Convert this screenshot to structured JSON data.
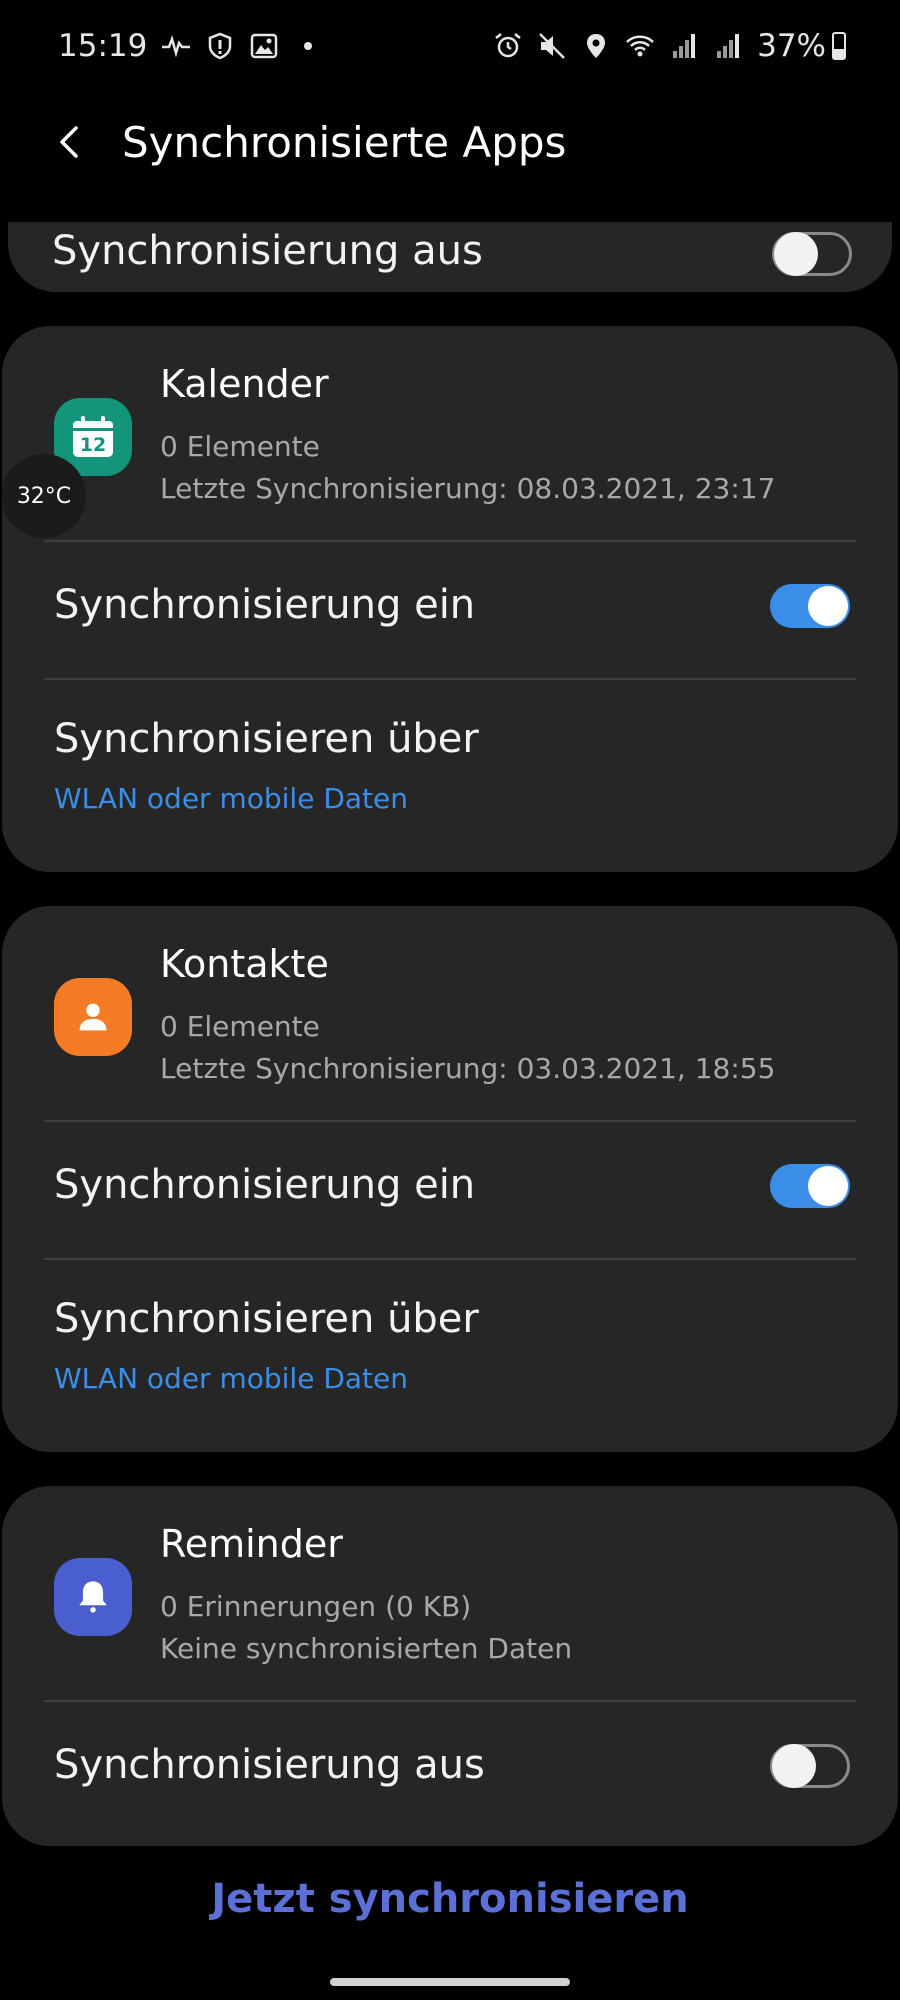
{
  "status_bar": {
    "time": "15:19",
    "battery": "37%",
    "battery_level": 0.37,
    "left_icons": [
      "pulse-icon",
      "shield-icon",
      "image-icon",
      "dot-icon"
    ],
    "right_icons": [
      "alarm-icon",
      "mute-icon",
      "location-icon",
      "wifi-icon",
      "signal-icon",
      "signal-icon"
    ]
  },
  "header": {
    "title": "Synchronisierte Apps"
  },
  "partial_card": {
    "sync_label": "Synchronisierung aus",
    "sync_on": false
  },
  "apps": [
    {
      "name": "Kalender",
      "items": "0 Elemente",
      "last_sync": "Letzte Synchronisierung: 08.03.2021, 23:17",
      "icon": "calendar-icon",
      "icon_text": "12",
      "icon_color": "#12957b",
      "sync_label": "Synchronisierung ein",
      "sync_on": true,
      "sync_via_label": "Synchronisieren über",
      "sync_via_value": "WLAN oder mobile Daten"
    },
    {
      "name": "Kontakte",
      "items": "0 Elemente",
      "last_sync": "Letzte Synchronisierung: 03.03.2021, 18:55",
      "icon": "contact-icon",
      "icon_color": "#f57c25",
      "sync_label": "Synchronisierung ein",
      "sync_on": true,
      "sync_via_label": "Synchronisieren über",
      "sync_via_value": "WLAN oder mobile Daten"
    },
    {
      "name": "Reminder",
      "items": "0 Erinnerungen (0 KB)",
      "last_sync": "Keine synchronisierten Daten",
      "icon": "bell-icon",
      "icon_color": "#4a5fcf",
      "sync_label": "Synchronisierung aus",
      "sync_on": false
    }
  ],
  "temperature_bubble": "32°C",
  "sync_now_button": "Jetzt synchronisieren",
  "colors": {
    "accent": "#3b8ee8",
    "card": "#262626",
    "background": "#000000",
    "sync_now": "#5b6fd6"
  }
}
